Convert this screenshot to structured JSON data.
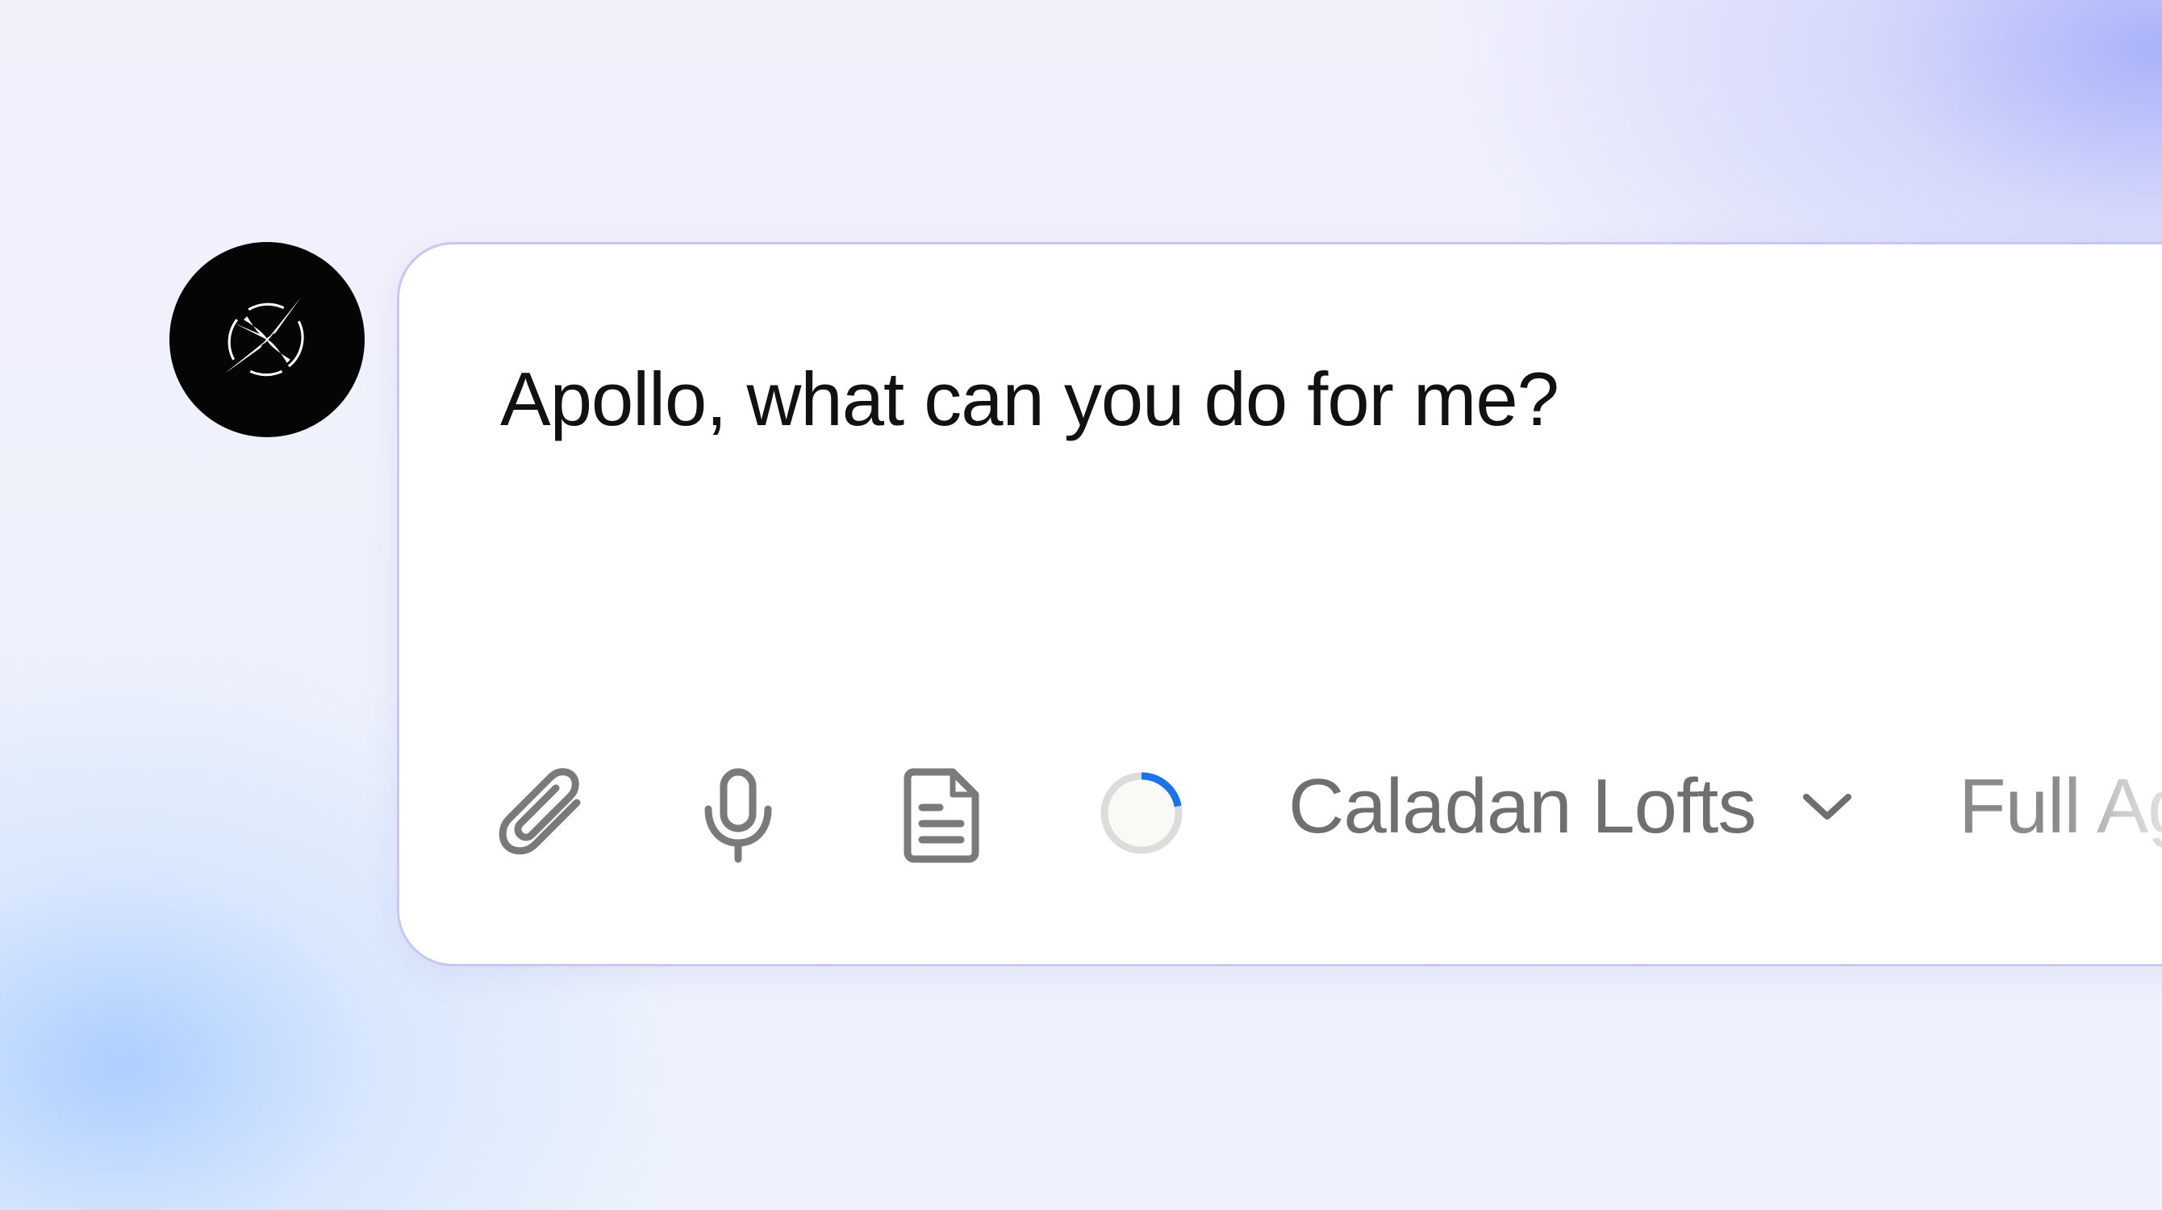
{
  "assistant": {
    "avatar_icon": "sparkle-logo-icon",
    "avatar_bg": "#050505"
  },
  "composer": {
    "prompt_text": "Apollo, what can you do for me?",
    "border_color": "#c9c6f2"
  },
  "toolbar": {
    "attach_icon": "paperclip-icon",
    "voice_icon": "microphone-icon",
    "document_icon": "document-icon",
    "context_icon": "progress-ring-icon",
    "context_progress": 0.22,
    "progress_color": "#1a73e8",
    "workspace_label": "Caladan Lofts",
    "workspace_chevron": "chevron-down-icon",
    "mode_label": "Full Ag"
  }
}
